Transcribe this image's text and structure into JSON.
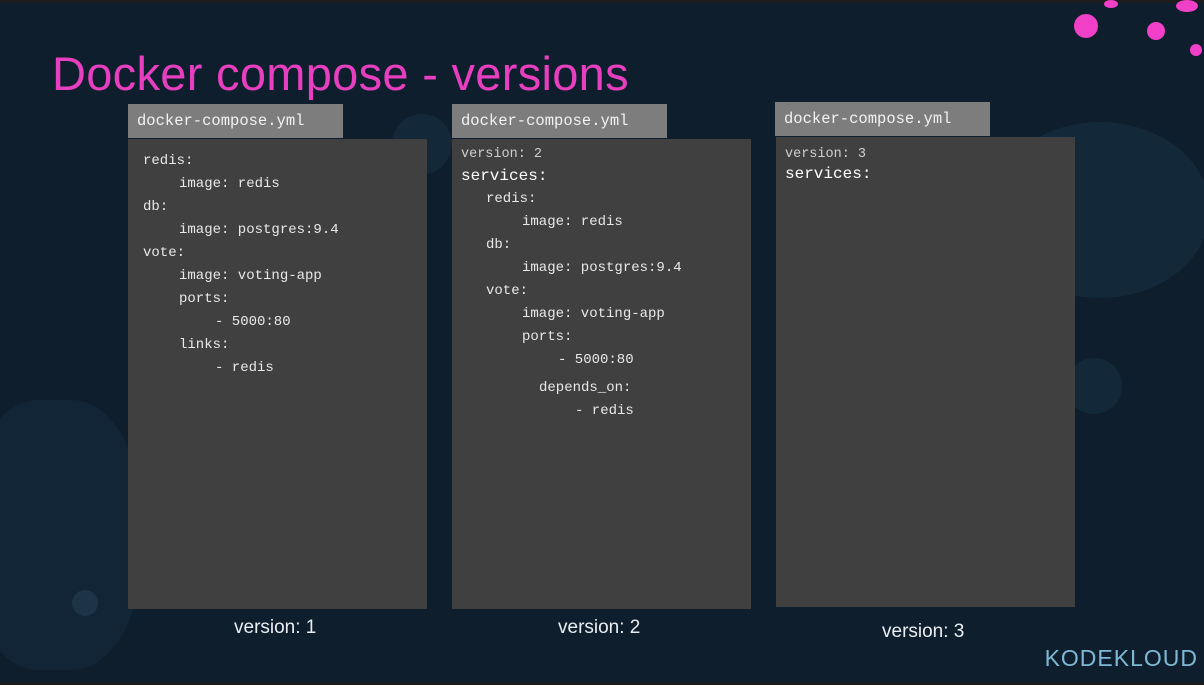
{
  "title": "Docker compose - versions",
  "colors": {
    "title": "#e83fc1",
    "panel": "#404040",
    "tab": "#7d7d7d",
    "background": "#0e1e2c",
    "accent_dots": "#f040c8",
    "logo": "#7fb8d6"
  },
  "panels": [
    {
      "tab": "docker-compose.yml",
      "caption": "version: 1",
      "lines": [
        "redis:",
        "image: redis",
        "db:",
        "image: postgres:9.4",
        "vote:",
        "image: voting-app",
        "ports:",
        "- 5000:80",
        "links:",
        "- redis"
      ]
    },
    {
      "tab": "docker-compose.yml",
      "caption": "version: 2",
      "lines": [
        "version: 2",
        "services:",
        "redis:",
        "image: redis",
        "db:",
        "image: postgres:9.4",
        "vote:",
        "image: voting-app",
        "ports:",
        "- 5000:80",
        "depends_on:",
        "- redis"
      ]
    },
    {
      "tab": "docker-compose.yml",
      "caption": "version: 3",
      "lines": [
        "version: 3",
        "services:"
      ]
    }
  ],
  "logo": "KODEKLOUD"
}
